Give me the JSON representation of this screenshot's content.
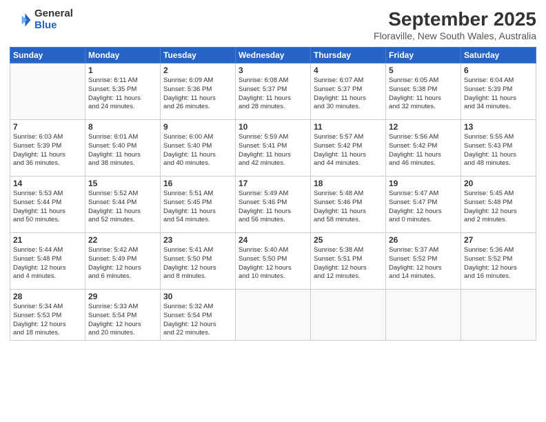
{
  "header": {
    "logo_general": "General",
    "logo_blue": "Blue",
    "title": "September 2025",
    "subtitle": "Floraville, New South Wales, Australia"
  },
  "days_of_week": [
    "Sunday",
    "Monday",
    "Tuesday",
    "Wednesday",
    "Thursday",
    "Friday",
    "Saturday"
  ],
  "weeks": [
    [
      {
        "day": "",
        "info": ""
      },
      {
        "day": "1",
        "info": "Sunrise: 6:11 AM\nSunset: 5:35 PM\nDaylight: 11 hours\nand 24 minutes."
      },
      {
        "day": "2",
        "info": "Sunrise: 6:09 AM\nSunset: 5:36 PM\nDaylight: 11 hours\nand 26 minutes."
      },
      {
        "day": "3",
        "info": "Sunrise: 6:08 AM\nSunset: 5:37 PM\nDaylight: 11 hours\nand 28 minutes."
      },
      {
        "day": "4",
        "info": "Sunrise: 6:07 AM\nSunset: 5:37 PM\nDaylight: 11 hours\nand 30 minutes."
      },
      {
        "day": "5",
        "info": "Sunrise: 6:05 AM\nSunset: 5:38 PM\nDaylight: 11 hours\nand 32 minutes."
      },
      {
        "day": "6",
        "info": "Sunrise: 6:04 AM\nSunset: 5:39 PM\nDaylight: 11 hours\nand 34 minutes."
      }
    ],
    [
      {
        "day": "7",
        "info": "Sunrise: 6:03 AM\nSunset: 5:39 PM\nDaylight: 11 hours\nand 36 minutes."
      },
      {
        "day": "8",
        "info": "Sunrise: 6:01 AM\nSunset: 5:40 PM\nDaylight: 11 hours\nand 38 minutes."
      },
      {
        "day": "9",
        "info": "Sunrise: 6:00 AM\nSunset: 5:40 PM\nDaylight: 11 hours\nand 40 minutes."
      },
      {
        "day": "10",
        "info": "Sunrise: 5:59 AM\nSunset: 5:41 PM\nDaylight: 11 hours\nand 42 minutes."
      },
      {
        "day": "11",
        "info": "Sunrise: 5:57 AM\nSunset: 5:42 PM\nDaylight: 11 hours\nand 44 minutes."
      },
      {
        "day": "12",
        "info": "Sunrise: 5:56 AM\nSunset: 5:42 PM\nDaylight: 11 hours\nand 46 minutes."
      },
      {
        "day": "13",
        "info": "Sunrise: 5:55 AM\nSunset: 5:43 PM\nDaylight: 11 hours\nand 48 minutes."
      }
    ],
    [
      {
        "day": "14",
        "info": "Sunrise: 5:53 AM\nSunset: 5:44 PM\nDaylight: 11 hours\nand 50 minutes."
      },
      {
        "day": "15",
        "info": "Sunrise: 5:52 AM\nSunset: 5:44 PM\nDaylight: 11 hours\nand 52 minutes."
      },
      {
        "day": "16",
        "info": "Sunrise: 5:51 AM\nSunset: 5:45 PM\nDaylight: 11 hours\nand 54 minutes."
      },
      {
        "day": "17",
        "info": "Sunrise: 5:49 AM\nSunset: 5:46 PM\nDaylight: 11 hours\nand 56 minutes."
      },
      {
        "day": "18",
        "info": "Sunrise: 5:48 AM\nSunset: 5:46 PM\nDaylight: 11 hours\nand 58 minutes."
      },
      {
        "day": "19",
        "info": "Sunrise: 5:47 AM\nSunset: 5:47 PM\nDaylight: 12 hours\nand 0 minutes."
      },
      {
        "day": "20",
        "info": "Sunrise: 5:45 AM\nSunset: 5:48 PM\nDaylight: 12 hours\nand 2 minutes."
      }
    ],
    [
      {
        "day": "21",
        "info": "Sunrise: 5:44 AM\nSunset: 5:48 PM\nDaylight: 12 hours\nand 4 minutes."
      },
      {
        "day": "22",
        "info": "Sunrise: 5:42 AM\nSunset: 5:49 PM\nDaylight: 12 hours\nand 6 minutes."
      },
      {
        "day": "23",
        "info": "Sunrise: 5:41 AM\nSunset: 5:50 PM\nDaylight: 12 hours\nand 8 minutes."
      },
      {
        "day": "24",
        "info": "Sunrise: 5:40 AM\nSunset: 5:50 PM\nDaylight: 12 hours\nand 10 minutes."
      },
      {
        "day": "25",
        "info": "Sunrise: 5:38 AM\nSunset: 5:51 PM\nDaylight: 12 hours\nand 12 minutes."
      },
      {
        "day": "26",
        "info": "Sunrise: 5:37 AM\nSunset: 5:52 PM\nDaylight: 12 hours\nand 14 minutes."
      },
      {
        "day": "27",
        "info": "Sunrise: 5:36 AM\nSunset: 5:52 PM\nDaylight: 12 hours\nand 16 minutes."
      }
    ],
    [
      {
        "day": "28",
        "info": "Sunrise: 5:34 AM\nSunset: 5:53 PM\nDaylight: 12 hours\nand 18 minutes."
      },
      {
        "day": "29",
        "info": "Sunrise: 5:33 AM\nSunset: 5:54 PM\nDaylight: 12 hours\nand 20 minutes."
      },
      {
        "day": "30",
        "info": "Sunrise: 5:32 AM\nSunset: 5:54 PM\nDaylight: 12 hours\nand 22 minutes."
      },
      {
        "day": "",
        "info": ""
      },
      {
        "day": "",
        "info": ""
      },
      {
        "day": "",
        "info": ""
      },
      {
        "day": "",
        "info": ""
      }
    ]
  ]
}
